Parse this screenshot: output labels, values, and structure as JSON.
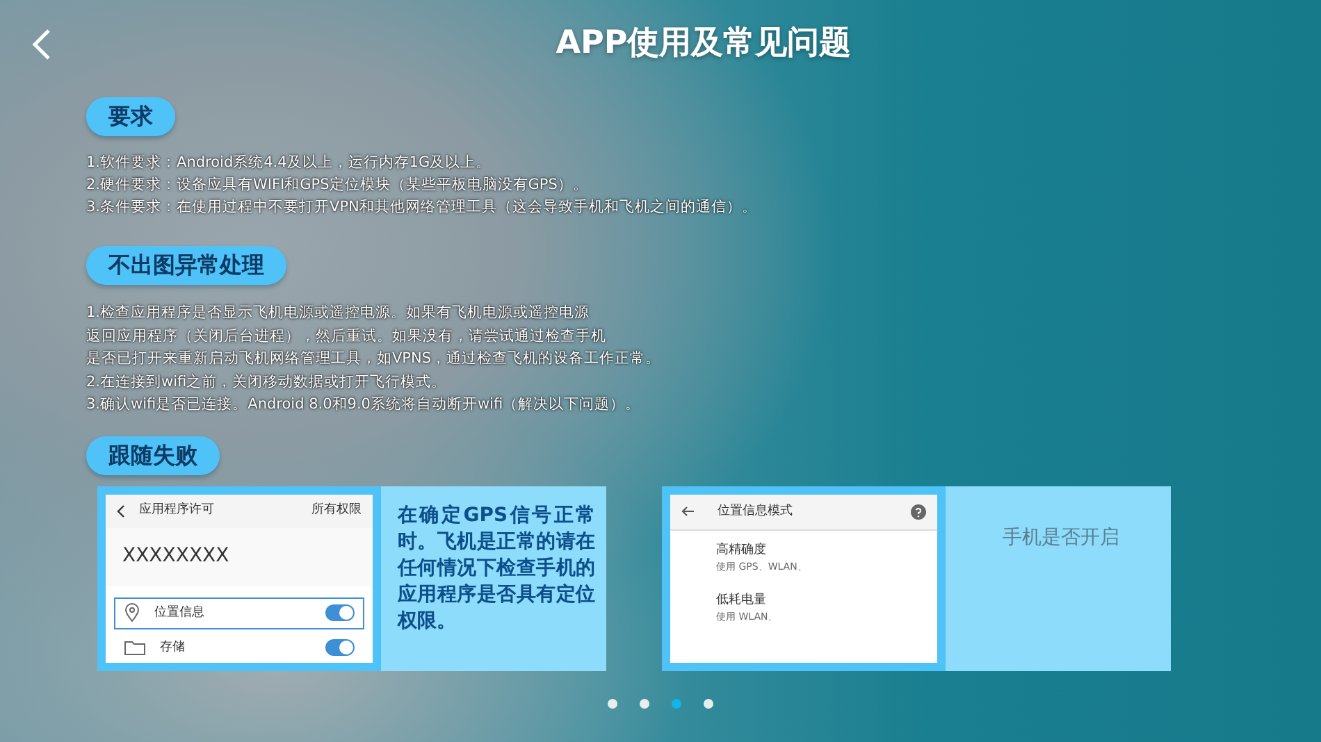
{
  "header": {
    "title": "APP使用及常见问题"
  },
  "sections": [
    {
      "heading": "要求",
      "lines": [
        "1.软件要求：Android系统4.4及以上，运行内存1G及以上。",
        "2.硬件要求：设备应具有WIFI和GPS定位模块（某些平板电脑没有GPS）。",
        "3.条件要求：在使用过程中不要打开VPN和其他网络管理工具（这会导致手机和飞机之间的通信）。"
      ]
    },
    {
      "heading": "不出图异常处理",
      "lines": [
        "1.检查应用程序是否显示飞机电源或遥控电源。如果有飞机电源或遥控电源",
        "返回应用程序（关闭后台进程），然后重试。如果没有，请尝试通过检查手机",
        "是否已打开来重新启动飞机网络管理工具，如VPNS，通过检查飞机的设备工作正常。",
        "2.在连接到wifi之前，关闭移动数据或打开飞行模式。",
        "3.确认wifi是否已连接。Android 8.0和9.0系统将自动断开wifi（解决以下问题）。"
      ]
    },
    {
      "heading": "跟随失败"
    }
  ],
  "cards": [
    {
      "screenshot": {
        "kind": "permissions",
        "title": "应用程序许可",
        "action": "所有权限",
        "app_name": "XXXXXXXX",
        "rows": [
          {
            "kind": "location",
            "label": "位置信息",
            "on": true,
            "selected": true
          },
          {
            "kind": "storage",
            "label": "存储",
            "on": true,
            "selected": false
          }
        ]
      },
      "caption": "在确定GPS信号正常时。飞机是正常的请在任何情况下检查手机的应用程序是否具有定位权限。"
    },
    {
      "screenshot": {
        "kind": "location_mode",
        "title": "位置信息模式",
        "options": [
          {
            "label": "高精确度",
            "detail": "使用 GPS、WLAN、"
          },
          {
            "label": "低耗电量",
            "detail": "使用 WLAN、"
          }
        ]
      },
      "caption": "手机是否开启"
    }
  ],
  "pagination": [
    {
      "selected": false
    },
    {
      "selected": false
    },
    {
      "selected": true
    },
    {
      "selected": false
    }
  ]
}
